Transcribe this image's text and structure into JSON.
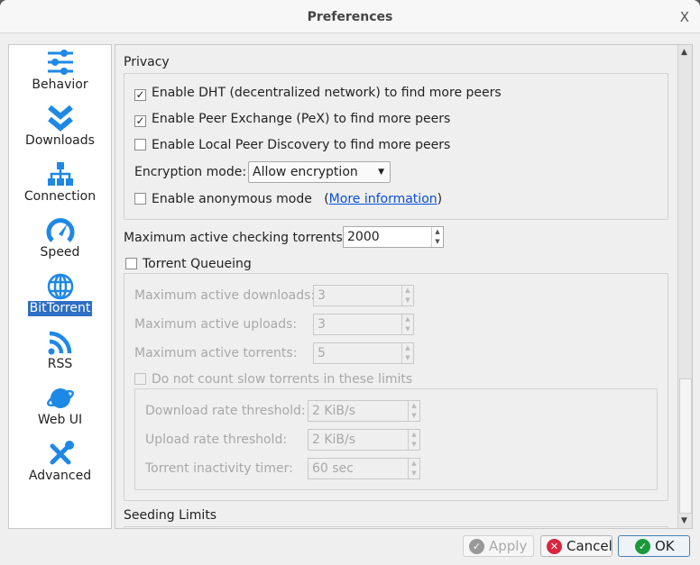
{
  "window": {
    "title": "Preferences",
    "close": "X"
  },
  "sidebar": {
    "items": [
      {
        "label": "Behavior",
        "icon": "sliders-icon"
      },
      {
        "label": "Downloads",
        "icon": "double-chevron-down-icon"
      },
      {
        "label": "Connection",
        "icon": "network-icon"
      },
      {
        "label": "Speed",
        "icon": "speedometer-icon"
      },
      {
        "label": "BitTorrent",
        "icon": "globe-icon",
        "selected": true
      },
      {
        "label": "RSS",
        "icon": "rss-icon"
      },
      {
        "label": "Web UI",
        "icon": "planet-icon"
      },
      {
        "label": "Advanced",
        "icon": "tools-icon"
      }
    ]
  },
  "privacy": {
    "title": "Privacy",
    "dht": {
      "label": "Enable DHT (decentralized network) to find more peers",
      "checked": true
    },
    "pex": {
      "label": "Enable Peer Exchange (PeX) to find more peers",
      "checked": true
    },
    "lpd": {
      "label": "Enable Local Peer Discovery to find more peers",
      "checked": false
    },
    "encryption_label": "Encryption mode:",
    "encryption_value": "Allow encryption",
    "anon": {
      "label": "Enable anonymous mode",
      "checked": false
    },
    "more_open": "(",
    "more_info": "More information",
    "more_close": ")"
  },
  "checking": {
    "label": "Maximum active checking torrents:",
    "value": "2000"
  },
  "queueing": {
    "label": "Torrent Queueing",
    "checked": false,
    "downloads_label": "Maximum active downloads:",
    "downloads": "3",
    "uploads_label": "Maximum active uploads:",
    "uploads": "3",
    "torrents_label": "Maximum active torrents:",
    "torrents": "5",
    "slow_label": "Do not count slow torrents in these limits",
    "dl_thresh_label": "Download rate threshold:",
    "dl_thresh": "2 KiB/s",
    "ul_thresh_label": "Upload rate threshold:",
    "ul_thresh": "2 KiB/s",
    "inactive_label": "Torrent inactivity timer:",
    "inactive": "60 sec"
  },
  "seeding": {
    "title": "Seeding Limits"
  },
  "buttons": {
    "apply": "Apply",
    "cancel": "Cancel",
    "ok": "OK"
  },
  "colors": {
    "icon_blue": "#1e88e5",
    "selection": "#2d6fc4",
    "link": "#0a4fd8"
  }
}
